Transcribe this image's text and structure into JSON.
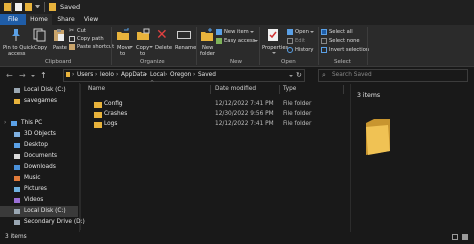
{
  "window": {
    "title": "Saved"
  },
  "tabs": [
    "File",
    "Home",
    "Share",
    "View"
  ],
  "ribbon": {
    "clipboard": {
      "pin": "Pin to Quick access",
      "pin_l1": "Pin to Quick",
      "pin_l2": "access",
      "copy": "Copy",
      "paste": "Paste",
      "cut": "Cut",
      "copy_path": "Copy path",
      "paste_shortcut": "Paste shortcut",
      "group": "Clipboard"
    },
    "organize": {
      "move_l1": "Move",
      "move_l2": "to",
      "copy_l1": "Copy",
      "copy_l2": "to",
      "delete": "Delete",
      "rename": "Rename",
      "group": "Organize"
    },
    "new": {
      "new_item": "New item",
      "easy_access": "Easy access",
      "new_folder_l1": "New",
      "new_folder_l2": "folder",
      "group": "New"
    },
    "open": {
      "properties": "Properties",
      "open": "Open",
      "edit": "Edit",
      "history": "History",
      "group": "Open"
    },
    "select": {
      "select_all": "Select all",
      "select_none": "Select none",
      "invert": "Invert selection",
      "group": "Select"
    }
  },
  "address": {
    "crumbs": [
      "Users",
      "leolo",
      "AppData",
      "Local",
      "Oregon",
      "Saved"
    ],
    "search_placeholder": "Search Saved"
  },
  "sidebar": {
    "items": [
      {
        "label": "Local Disk (C:)",
        "icon": "drive-icon",
        "indent": 1
      },
      {
        "label": "savegames",
        "icon": "folder-icon",
        "indent": 1
      },
      {
        "label": "",
        "icon": "",
        "indent": 0
      },
      {
        "label": "This PC",
        "icon": "pc-icon",
        "indent": 0
      },
      {
        "label": "3D Objects",
        "icon": "3d-icon",
        "indent": 1
      },
      {
        "label": "Desktop",
        "icon": "desktop-icon",
        "indent": 1
      },
      {
        "label": "Documents",
        "icon": "documents-icon",
        "indent": 1
      },
      {
        "label": "Downloads",
        "icon": "downloads-icon",
        "indent": 1
      },
      {
        "label": "Music",
        "icon": "music-icon",
        "indent": 1
      },
      {
        "label": "Pictures",
        "icon": "pictures-icon",
        "indent": 1
      },
      {
        "label": "Videos",
        "icon": "videos-icon",
        "indent": 1
      },
      {
        "label": "Local Disk (C:)",
        "icon": "drive-icon",
        "indent": 1,
        "selected": true
      },
      {
        "label": "Secondary Drive (D:)",
        "icon": "drive-icon",
        "indent": 1
      }
    ]
  },
  "content": {
    "columns": [
      "Name",
      "Date modified",
      "Type"
    ],
    "rows": [
      {
        "name": "Config",
        "date": "12/12/2022 7:41 PM",
        "type": "File folder"
      },
      {
        "name": "Crashes",
        "date": "12/30/2022 9:56 PM",
        "type": "File folder"
      },
      {
        "name": "Logs",
        "date": "12/12/2022 7:41 PM",
        "type": "File folder"
      }
    ]
  },
  "preview": {
    "title": "3 items"
  },
  "status": {
    "text": "3 items"
  },
  "colors": {
    "accent": "#1f5da8",
    "folder": "#e8b33c",
    "background": "#191919"
  }
}
